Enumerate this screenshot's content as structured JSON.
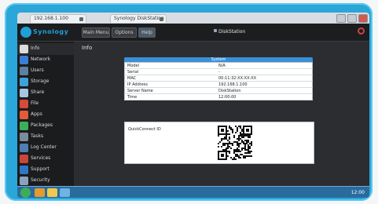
{
  "browser": {
    "tabs": [
      {
        "label": "192.168.1.100"
      },
      {
        "label": "Synology DiskStation"
      }
    ]
  },
  "header": {
    "logo_text": "Synology",
    "buttons": [
      {
        "label": "Main Menu"
      },
      {
        "label": "Options"
      },
      {
        "label": "Help"
      }
    ],
    "hostname": "DiskStation"
  },
  "sidebar": {
    "items": [
      {
        "label": "Info",
        "color": "#dcdcdc"
      },
      {
        "label": "Network",
        "color": "#3b7fd4"
      },
      {
        "label": "Users",
        "color": "#5f7fa0"
      },
      {
        "label": "Storage",
        "color": "#3ea2d8"
      },
      {
        "label": "Share",
        "color": "#a8c5e3"
      },
      {
        "label": "File",
        "color": "#d44a3b"
      },
      {
        "label": "Apps",
        "color": "#e25c3a"
      },
      {
        "label": "Packages",
        "color": "#3cae5a"
      },
      {
        "label": "Tasks",
        "color": "#7a8c9e"
      },
      {
        "label": "Log Center",
        "color": "#4d7fb3"
      },
      {
        "label": "Services",
        "color": "#c9473a"
      },
      {
        "label": "Support",
        "color": "#2f76c7"
      },
      {
        "label": "Security",
        "color": "#8aa2bd"
      }
    ]
  },
  "content": {
    "title": "Info",
    "panel_header": "System",
    "rows": [
      {
        "key": "Model",
        "value": "N/A"
      },
      {
        "key": "Serial",
        "value": "-"
      },
      {
        "key": "MAC",
        "value": "00:11:32:XX:XX:XX"
      },
      {
        "key": "IP Address",
        "value": "192.168.1.100"
      },
      {
        "key": "Server Name",
        "value": "DiskStation"
      },
      {
        "key": "Time",
        "value": "12:00:00"
      }
    ],
    "qr_label": "QuickConnect ID"
  },
  "taskbar": {
    "clock": "12:00"
  }
}
